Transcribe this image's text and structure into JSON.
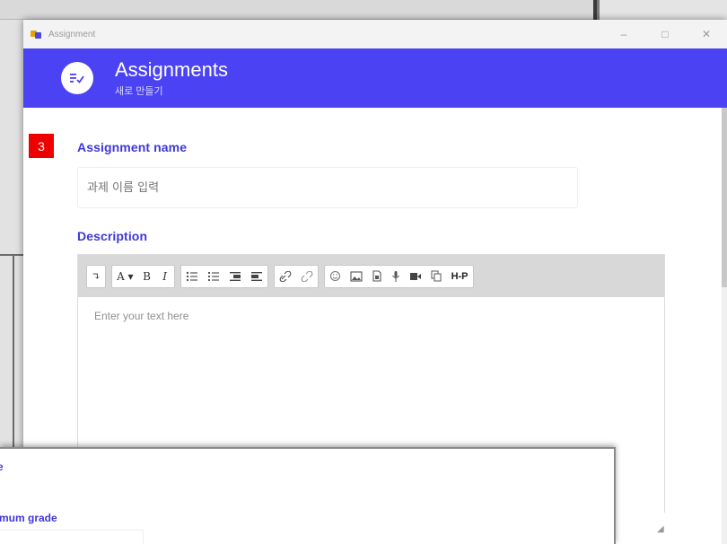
{
  "window": {
    "title": "Assignment",
    "controls": {
      "minimize": "–",
      "maximize": "□",
      "close": "✕"
    }
  },
  "header": {
    "title": "Assignments",
    "subtitle": "새로 만들기",
    "icon": "assignment-check-icon"
  },
  "step_badge": "3",
  "form": {
    "name_label": "Assignment name",
    "name_placeholder": "과제 이름 입력",
    "description_label": "Description",
    "description_placeholder": "Enter your text here"
  },
  "toolbar": {
    "groups": [
      [
        "expand-icon"
      ],
      [
        "font-size-icon",
        "bold-icon",
        "italic-icon"
      ],
      [
        "bullet-list-icon",
        "numbered-list-icon",
        "indent-icon",
        "outdent-icon"
      ],
      [
        "link-icon",
        "unlink-icon"
      ],
      [
        "emoji-icon",
        "image-icon",
        "file-icon",
        "record-audio-icon",
        "record-video-icon",
        "copy-icon",
        "h5p-icon"
      ]
    ],
    "labels": {
      "expand": "↴",
      "font_size": "A ▾",
      "bold": "B",
      "italic": "I",
      "h5p": "H-P"
    }
  },
  "bottom_window": {
    "label_top": "e",
    "label_grade": "mum grade"
  },
  "colors": {
    "accent": "#4b42f3",
    "label": "#3f37d9",
    "badge": "#ee0000"
  }
}
